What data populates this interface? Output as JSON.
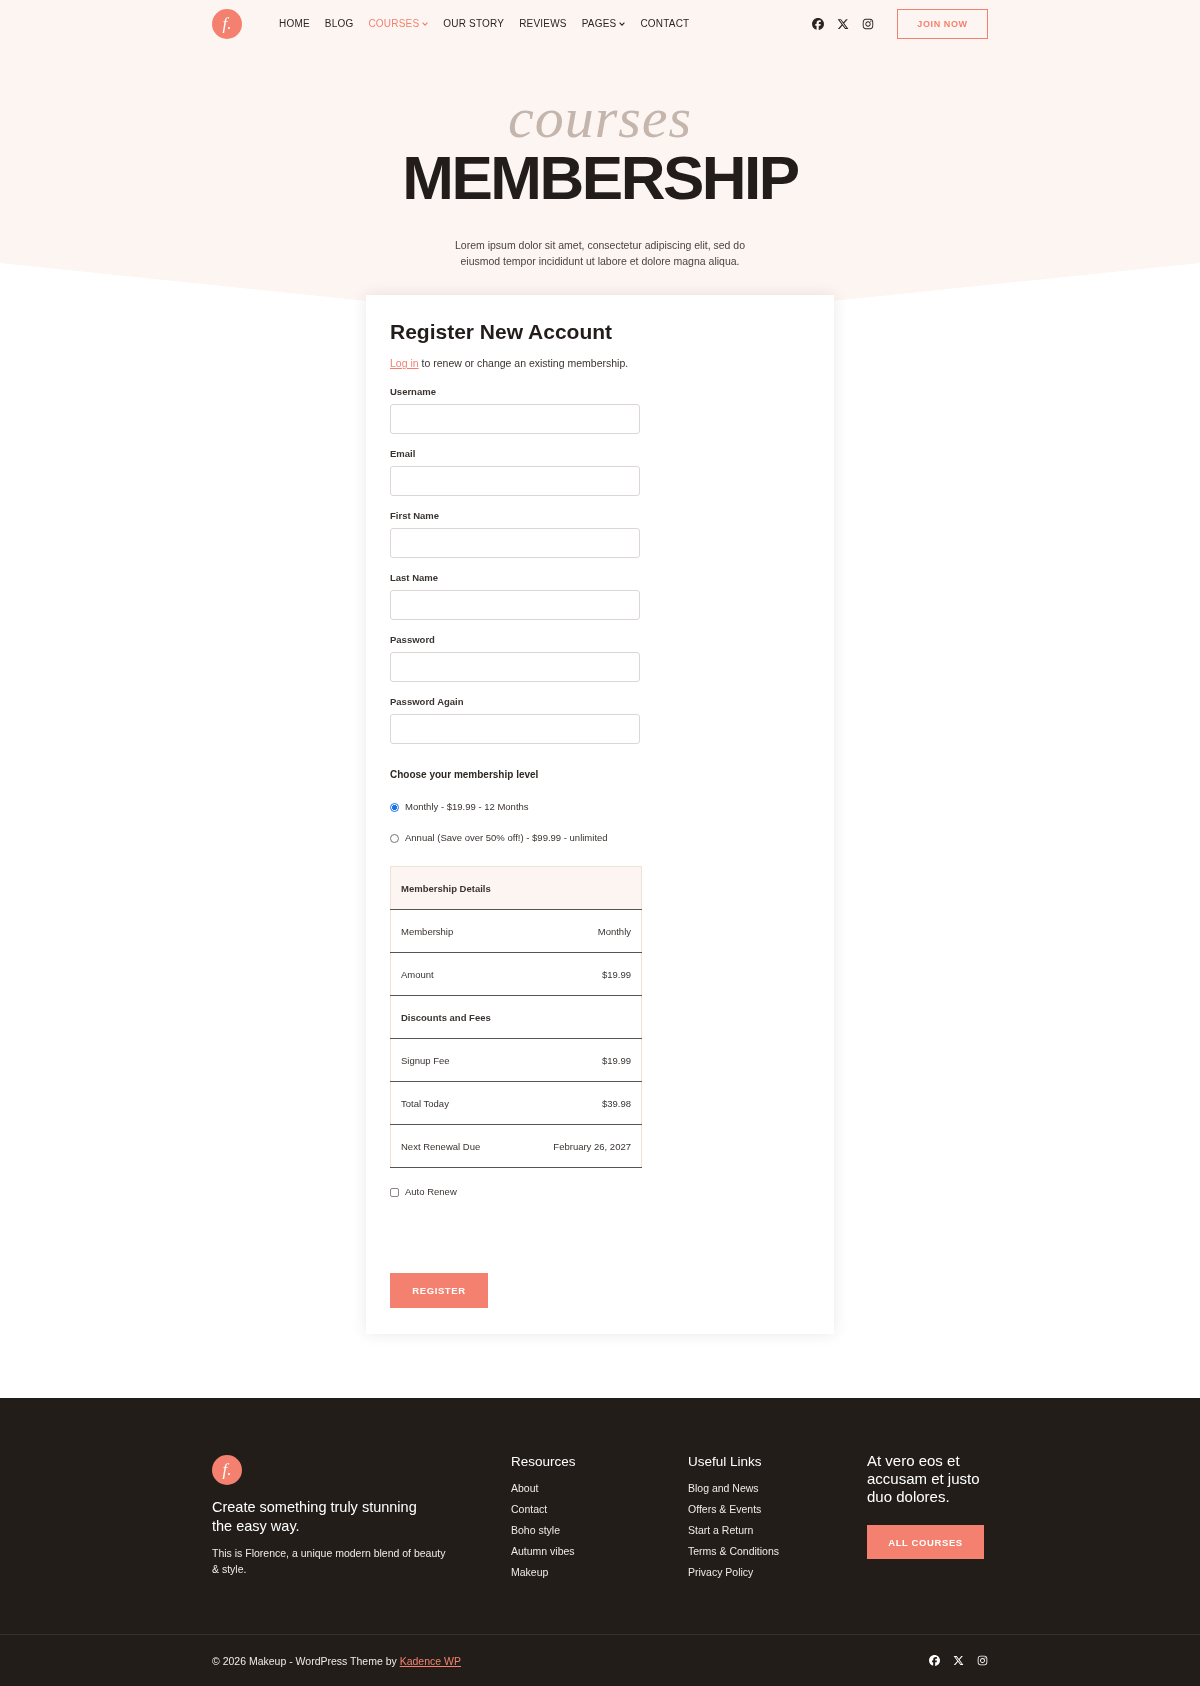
{
  "header": {
    "logo": "f.",
    "nav": [
      {
        "label": "HOME",
        "selected": false,
        "dropdown": false
      },
      {
        "label": "BLOG",
        "selected": false,
        "dropdown": false
      },
      {
        "label": "COURSES",
        "selected": true,
        "dropdown": true
      },
      {
        "label": "OUR STORY",
        "selected": false,
        "dropdown": false
      },
      {
        "label": "REVIEWS",
        "selected": false,
        "dropdown": false
      },
      {
        "label": "PAGES",
        "selected": false,
        "dropdown": true
      },
      {
        "label": "CONTACT",
        "selected": false,
        "dropdown": false
      }
    ],
    "join_button": "JOIN NOW"
  },
  "hero": {
    "script": "courses",
    "title": "MEMBERSHIP",
    "text": "Lorem ipsum dolor sit amet, consectetur adipiscing elit, sed do eiusmod tempor incididunt ut labore et dolore magna aliqua."
  },
  "form": {
    "title": "Register New Account",
    "login_link": "Log in",
    "login_text": "to renew or change an existing membership.",
    "fields": [
      {
        "label": "Username"
      },
      {
        "label": "Email"
      },
      {
        "label": "First Name"
      },
      {
        "label": "Last Name"
      },
      {
        "label": "Password"
      },
      {
        "label": "Password Again"
      }
    ],
    "level_heading": "Choose your membership level",
    "levels": [
      {
        "label": "Monthly - $19.99 - 12 Months",
        "selected": true
      },
      {
        "label": "Annual (Save over 50% off!) - $99.99 - unlimited",
        "selected": false
      }
    ],
    "details": [
      {
        "kind": "header",
        "label": "Membership Details"
      },
      {
        "kind": "item",
        "label": "Membership",
        "value": "Monthly"
      },
      {
        "kind": "item",
        "label": "Amount",
        "value": "$19.99"
      },
      {
        "kind": "section",
        "label": "Discounts and Fees"
      },
      {
        "kind": "item",
        "label": "Signup Fee",
        "value": "$19.99"
      },
      {
        "kind": "item",
        "label": "Total Today",
        "value": "$39.98"
      },
      {
        "kind": "item",
        "label": "Next Renewal Due",
        "value": "February 26, 2027"
      }
    ],
    "auto_renew": {
      "label": "Auto Renew",
      "checked": false
    },
    "submit": "REGISTER"
  },
  "footer": {
    "logo": "f.",
    "tagline": "Create something truly stunning the easy way.",
    "description": "This is Florence, a unique modern blend of beauty & style.",
    "columns": [
      {
        "title": "Resources",
        "links": [
          "About",
          "Contact",
          "Boho style",
          "Autumn vibes",
          "Makeup"
        ]
      },
      {
        "title": "Useful Links",
        "links": [
          "Blog and News",
          "Offers & Events",
          "Start a Return",
          "Terms & Conditions",
          "Privacy Policy"
        ]
      }
    ],
    "cta": {
      "text": "At vero eos et accusam et justo duo dolores.",
      "button": "ALL COURSES"
    },
    "copyright": "© 2026 Makeup - WordPress Theme by",
    "credit_link": "Kadence WP"
  }
}
